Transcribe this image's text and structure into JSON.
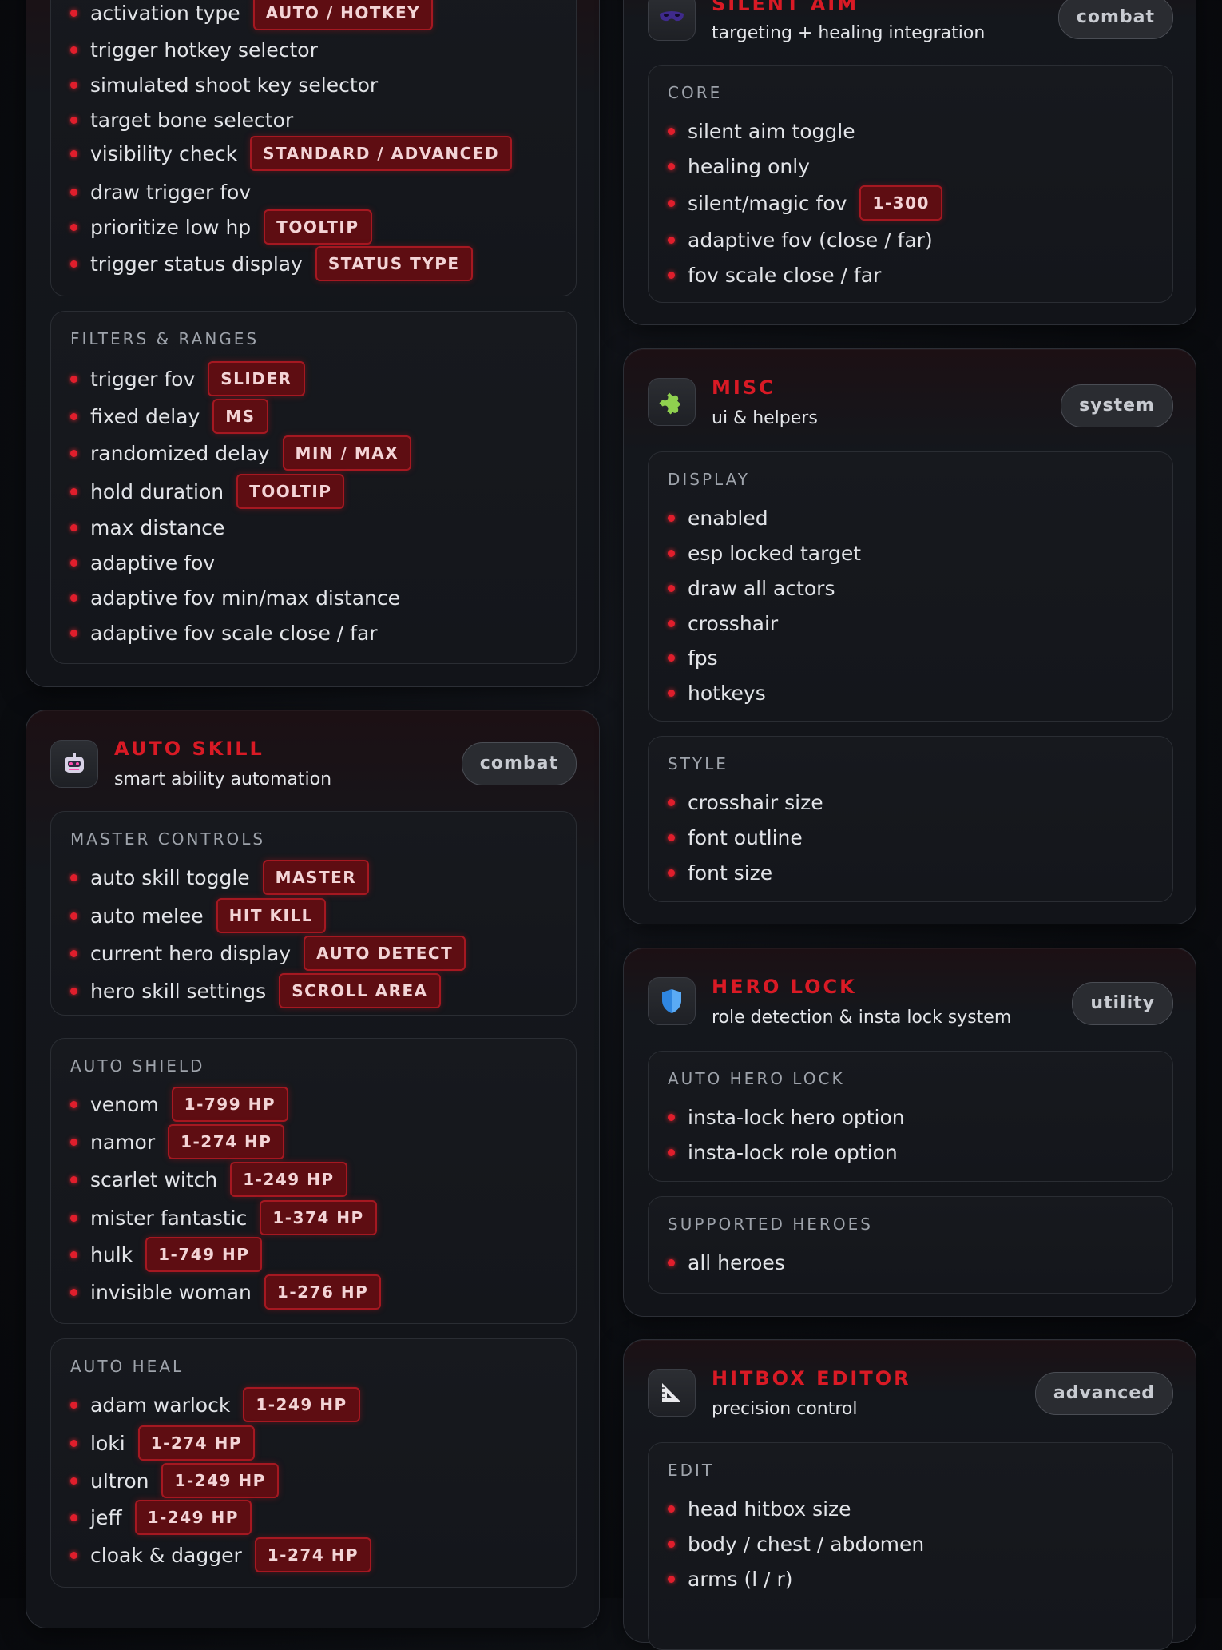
{
  "left_top": {
    "items": [
      {
        "label": "activation type",
        "tag": "AUTO / HOTKEY"
      },
      {
        "label": "trigger hotkey selector"
      },
      {
        "label": "simulated shoot key selector"
      },
      {
        "label": "target bone selector"
      },
      {
        "label": "visibility check",
        "tag": "STANDARD / ADVANCED"
      },
      {
        "label": "draw trigger fov"
      },
      {
        "label": "prioritize low hp",
        "tag": "TOOLTIP"
      },
      {
        "label": "trigger status display",
        "tag": "STATUS TYPE"
      }
    ],
    "filters": {
      "title": "FILTERS & RANGES",
      "items": [
        {
          "label": "trigger fov",
          "tag": "SLIDER"
        },
        {
          "label": "fixed delay",
          "tag": "MS"
        },
        {
          "label": "randomized delay",
          "tag": "MIN / MAX"
        },
        {
          "label": "hold duration",
          "tag": "TOOLTIP"
        },
        {
          "label": "max distance"
        },
        {
          "label": "adaptive fov"
        },
        {
          "label": "adaptive fov min/max distance"
        },
        {
          "label": "adaptive fov scale close / far"
        }
      ]
    }
  },
  "auto_skill": {
    "title": "AUTO SKILL",
    "subtitle": "smart ability automation",
    "badge": "combat",
    "icon": "robot-icon",
    "master": {
      "title": "MASTER CONTROLS",
      "items": [
        {
          "label": "auto skill toggle",
          "tag": "MASTER"
        },
        {
          "label": "auto melee",
          "tag": "HIT KILL"
        },
        {
          "label": "current hero display",
          "tag": "AUTO DETECT"
        },
        {
          "label": "hero skill settings",
          "tag": "SCROLL AREA"
        }
      ]
    },
    "shield": {
      "title": "AUTO SHIELD",
      "items": [
        {
          "label": "venom",
          "tag": "1-799 HP"
        },
        {
          "label": "namor",
          "tag": "1-274 HP"
        },
        {
          "label": "scarlet witch",
          "tag": "1-249 HP"
        },
        {
          "label": "mister fantastic",
          "tag": "1-374 HP"
        },
        {
          "label": "hulk",
          "tag": "1-749 HP"
        },
        {
          "label": "invisible woman",
          "tag": "1-276 HP"
        }
      ]
    },
    "heal": {
      "title": "AUTO HEAL",
      "items": [
        {
          "label": "adam warlock",
          "tag": "1-249 HP"
        },
        {
          "label": "loki",
          "tag": "1-274 HP"
        },
        {
          "label": "ultron",
          "tag": "1-249 HP"
        },
        {
          "label": "jeff",
          "tag": "1-249 HP"
        },
        {
          "label": "cloak & dagger",
          "tag": "1-274 HP"
        }
      ]
    }
  },
  "silent_aim": {
    "title": "SILENT AIM",
    "subtitle": "targeting + healing integration",
    "badge": "combat",
    "icon": "mask-icon",
    "core": {
      "title": "CORE",
      "items": [
        {
          "label": "silent aim toggle"
        },
        {
          "label": "healing only"
        },
        {
          "label": "silent/magic fov",
          "tag": "1-300"
        },
        {
          "label": "adaptive fov (close / far)"
        },
        {
          "label": "fov scale close / far"
        }
      ]
    }
  },
  "misc": {
    "title": "MISC",
    "subtitle": "ui & helpers",
    "badge": "system",
    "icon": "puzzle-icon",
    "display": {
      "title": "DISPLAY",
      "items": [
        {
          "label": "enabled"
        },
        {
          "label": "esp locked target"
        },
        {
          "label": "draw all actors"
        },
        {
          "label": "crosshair"
        },
        {
          "label": "fps"
        },
        {
          "label": "hotkeys"
        }
      ]
    },
    "style": {
      "title": "STYLE",
      "items": [
        {
          "label": "crosshair size"
        },
        {
          "label": "font outline"
        },
        {
          "label": "font size"
        }
      ]
    }
  },
  "hero_lock": {
    "title": "HERO LOCK",
    "subtitle": "role detection & insta lock system",
    "badge": "utility",
    "icon": "shield-icon",
    "auto": {
      "title": "AUTO HERO LOCK",
      "items": [
        {
          "label": "insta-lock hero option"
        },
        {
          "label": "insta-lock role option"
        }
      ]
    },
    "supported": {
      "title": "SUPPORTED HEROES",
      "items": [
        {
          "label": "all heroes"
        }
      ]
    }
  },
  "hitbox_editor": {
    "title": "HITBOX EDITOR",
    "subtitle": "precision control",
    "badge": "advanced",
    "icon": "triangle-ruler-icon",
    "edit": {
      "title": "EDIT",
      "items": [
        {
          "label": "head hitbox size"
        },
        {
          "label": "body / chest / abdomen"
        },
        {
          "label": "arms (l / r)"
        }
      ]
    }
  }
}
